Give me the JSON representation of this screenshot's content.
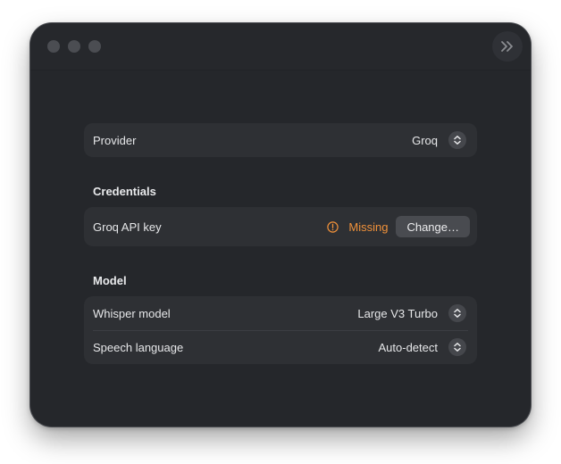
{
  "provider": {
    "label": "Provider",
    "value": "Groq"
  },
  "credentials": {
    "section_title": "Credentials",
    "api_key_label": "Groq API key",
    "status_text": "Missing",
    "change_button": "Change…"
  },
  "model": {
    "section_title": "Model",
    "whisper_label": "Whisper model",
    "whisper_value": "Large V3 Turbo",
    "language_label": "Speech language",
    "language_value": "Auto-detect"
  },
  "icons": {
    "sidebar_toggle": "chevrons-right-icon",
    "stepper": "up-down-chevron-icon",
    "warning": "exclamation-circle-icon"
  },
  "colors": {
    "window_bg": "#25272b",
    "group_bg": "#2e3034",
    "warning": "#f0913a"
  }
}
